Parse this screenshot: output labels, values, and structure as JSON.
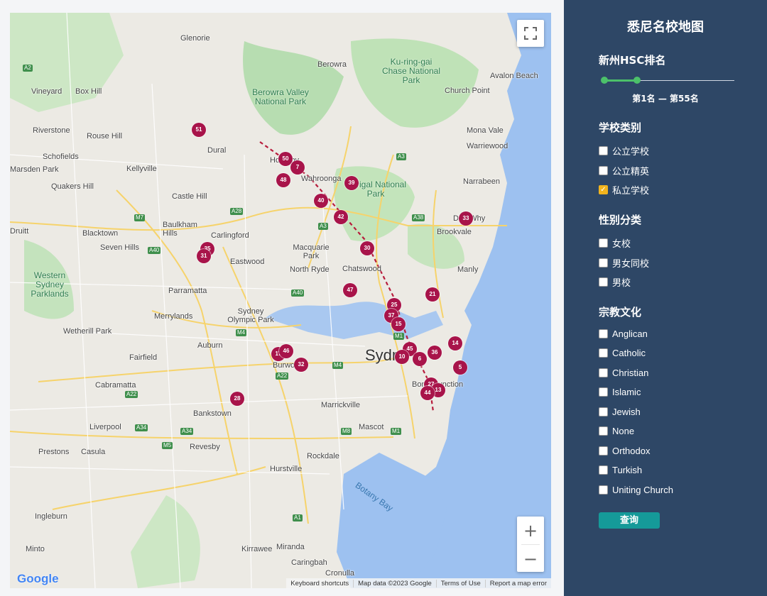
{
  "sidebar": {
    "title": "悉尼名校地图",
    "ranking": {
      "label": "新州HSC排名",
      "min": 1,
      "max": 55,
      "range_text": "第1名 — 第55名"
    },
    "school_type": {
      "label": "学校类别",
      "options": [
        {
          "label": "公立学校",
          "checked": false
        },
        {
          "label": "公立精英",
          "checked": false
        },
        {
          "label": "私立学校",
          "checked": true
        }
      ]
    },
    "gender": {
      "label": "性别分类",
      "options": [
        {
          "label": "女校",
          "checked": false
        },
        {
          "label": "男女同校",
          "checked": false
        },
        {
          "label": "男校",
          "checked": false
        }
      ]
    },
    "religion": {
      "label": "宗教文化",
      "options": [
        {
          "label": "Anglican",
          "checked": false
        },
        {
          "label": "Catholic",
          "checked": false
        },
        {
          "label": "Christian",
          "checked": false
        },
        {
          "label": "Islamic",
          "checked": false
        },
        {
          "label": "Jewish",
          "checked": false
        },
        {
          "label": "None",
          "checked": false
        },
        {
          "label": "Orthodox",
          "checked": false
        },
        {
          "label": "Turkish",
          "checked": false
        },
        {
          "label": "Uniting Church",
          "checked": false
        }
      ]
    },
    "query_label": "查询"
  },
  "map": {
    "city_label": "Sydn",
    "places": [
      "Glenorie",
      "Berowra",
      "Ku-ring-gai Chase National Park",
      "Avalon Beach",
      "Church Point",
      "Vineyard",
      "Box Hill",
      "Berowra Valley National Park",
      "Riverstone",
      "Rouse Hill",
      "Dural",
      "Mona Vale",
      "Warriewood",
      "Schofields",
      "Kellyville",
      "Hornsby",
      "Wahroonga",
      "Garigal National Park",
      "Narrabeen",
      "Marsden Park",
      "Quakers Hill",
      "Castle Hill",
      "Dee Why",
      "Brookvale",
      "Baulkham Hills",
      "Carlingford",
      "Druitt",
      "Blacktown",
      "Seven Hills",
      "Macquarie Park",
      "Chatswood",
      "Eastwood",
      "North Ryde",
      "Manly",
      "Western Sydney Parklands",
      "Parramatta",
      "Merrylands",
      "Sydney Olympic Park",
      "Wetherill Park",
      "Fairfield",
      "Auburn",
      "Burwood",
      "Bondi Junction",
      "Cabramatta",
      "Bankstown",
      "Marrickville",
      "Liverpool",
      "Mascot",
      "Prestons",
      "Casula",
      "Revesby",
      "Rockdale",
      "Hurstville",
      "Botany Bay",
      "Ingleburn",
      "Minto",
      "Kirrawee",
      "Miranda",
      "Caringbah",
      "Cronulla"
    ],
    "markers": [
      "51",
      "50",
      "7",
      "48",
      "39",
      "40",
      "42",
      "33",
      "35",
      "31",
      "30",
      "47",
      "21",
      "25",
      "37",
      "15",
      "14",
      "45",
      "10",
      "6",
      "36",
      "5",
      "27",
      "13",
      "44",
      "17",
      "46",
      "32",
      "28"
    ],
    "attribution": [
      "Keyboard shortcuts",
      "Map data ©2023 Google",
      "Terms of Use",
      "Report a map error"
    ],
    "logo": "Google",
    "zoom_in": "+",
    "zoom_out": "−"
  }
}
